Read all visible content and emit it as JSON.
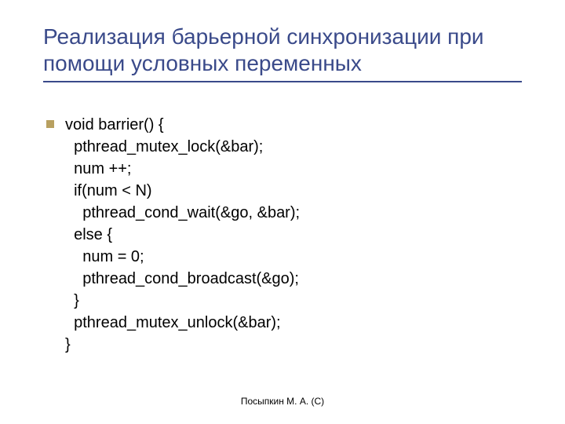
{
  "title": "Реализация барьерной синхронизации при помощи условных переменных",
  "code": {
    "l0": "void barrier() {",
    "l1": "  pthread_mutex_lock(&bar);",
    "l2": "  num ++;",
    "l3": "  if(num < N)",
    "l4": "    pthread_cond_wait(&go, &bar);",
    "l5": "  else {",
    "l6": "    num = 0;",
    "l7": "    pthread_cond_broadcast(&go);",
    "l8": "  }",
    "l9": "  pthread_mutex_unlock(&bar);",
    "l10": "}"
  },
  "footer": "Посыпкин М. А. (С)"
}
